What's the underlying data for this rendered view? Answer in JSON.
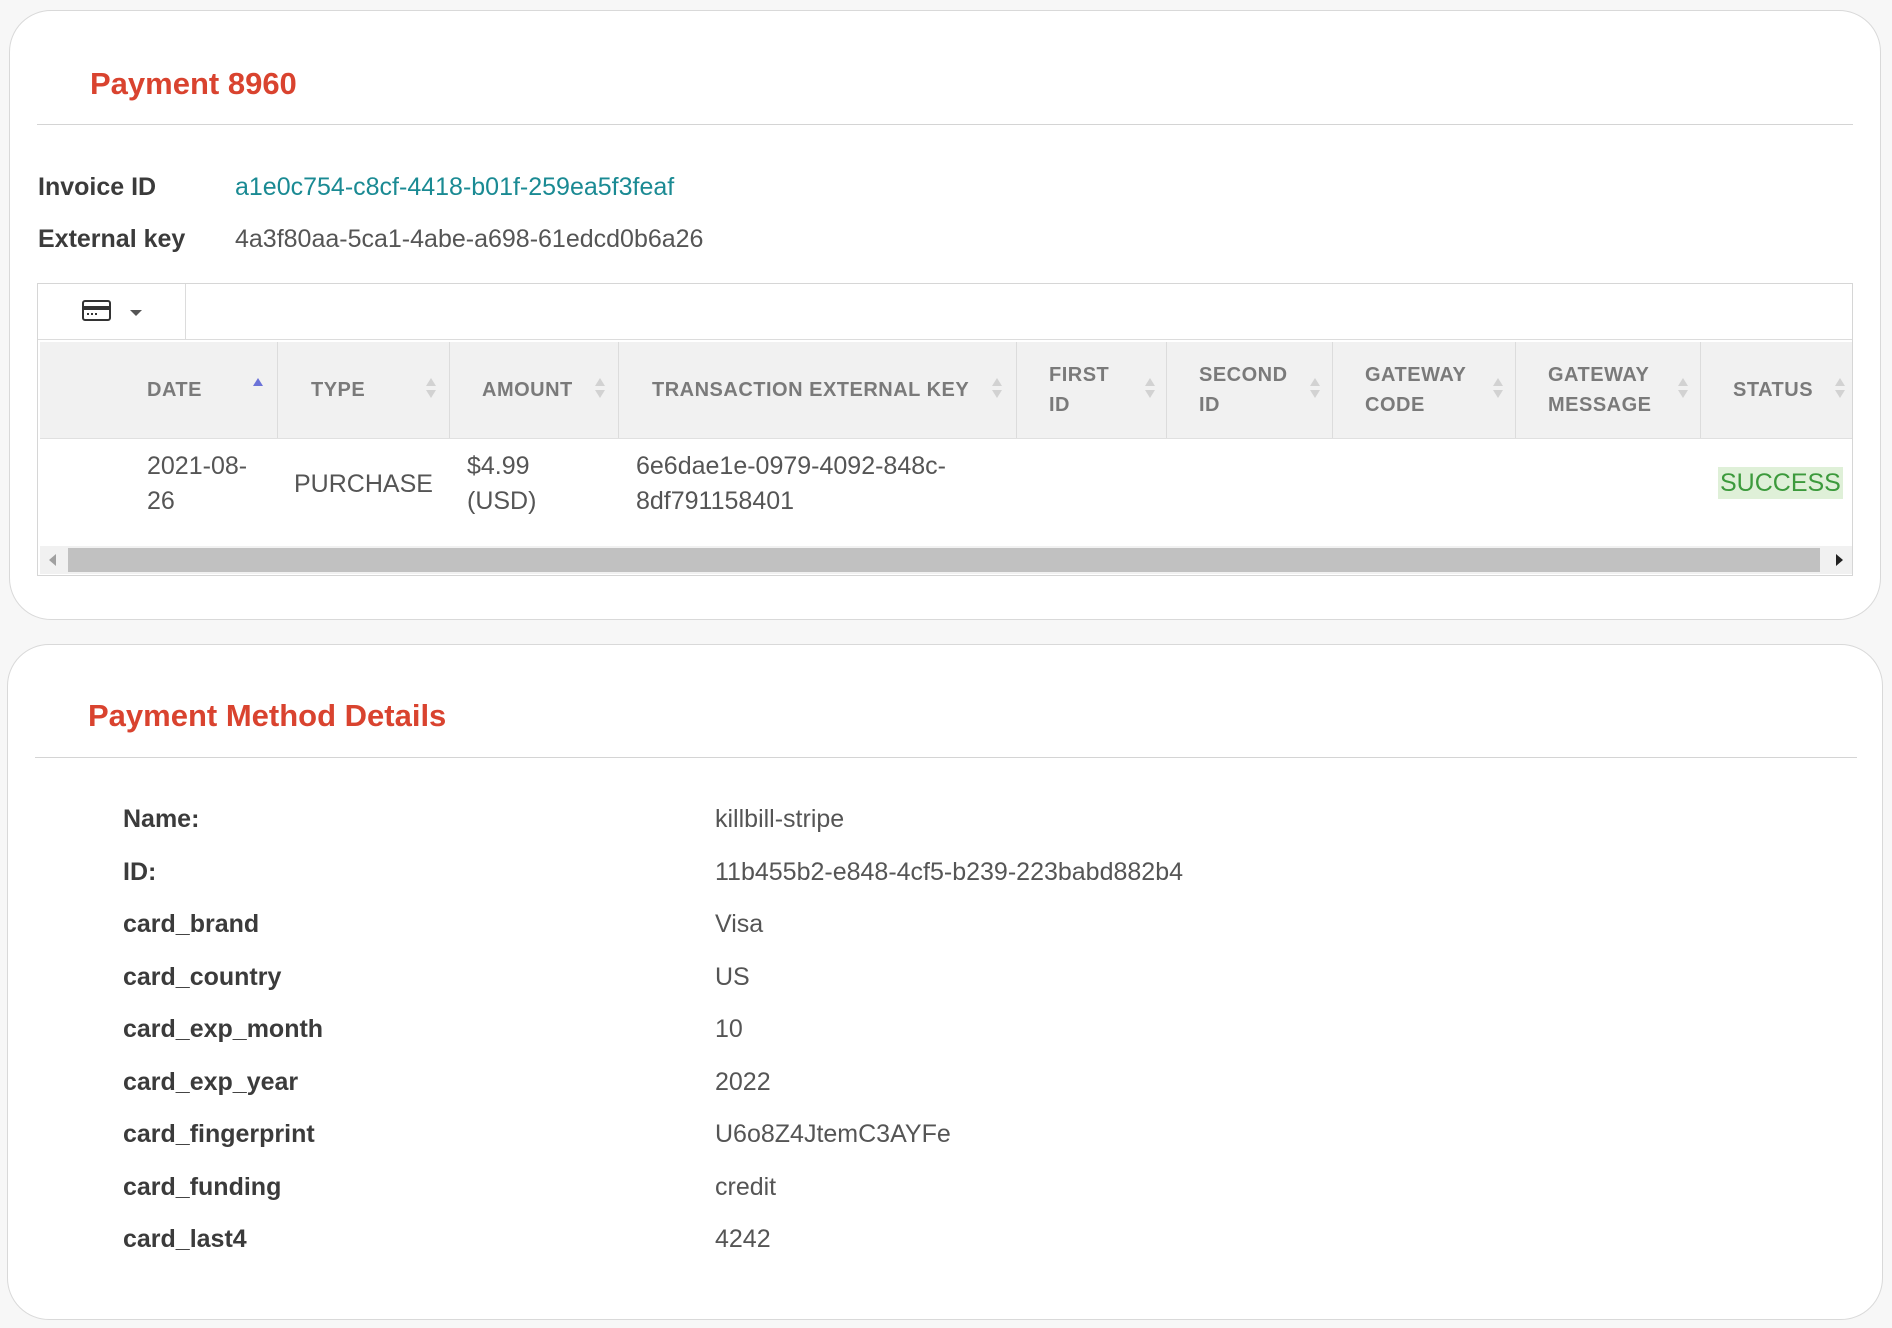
{
  "payment": {
    "title": "Payment 8960",
    "invoice_id_label": "Invoice ID",
    "invoice_id_value": "a1e0c754-c8cf-4418-b01f-259ea5f3feaf",
    "external_key_label": "External key",
    "external_key_value": "4a3f80aa-5ca1-4abe-a698-61edcd0b6a26"
  },
  "table": {
    "toolbar": {
      "icon": "credit-card-icon"
    },
    "columns": [
      {
        "line1": "DATE",
        "line2": "",
        "sort": "asc"
      },
      {
        "line1": "TYPE",
        "line2": "",
        "sort": "none"
      },
      {
        "line1": "AMOUNT",
        "line2": "",
        "sort": "none"
      },
      {
        "line1": "TRANSACTION EXTERNAL KEY",
        "line2": "",
        "sort": "none"
      },
      {
        "line1": "FIRST",
        "line2": "ID",
        "sort": "none"
      },
      {
        "line1": "SECOND",
        "line2": "ID",
        "sort": "none"
      },
      {
        "line1": "GATEWAY",
        "line2": "CODE",
        "sort": "none"
      },
      {
        "line1": "GATEWAY",
        "line2": "MESSAGE",
        "sort": "none"
      },
      {
        "line1": "STATUS",
        "line2": "",
        "sort": "none"
      }
    ],
    "rows": [
      {
        "date_line1": "2021-08-",
        "date_line2": "26",
        "type": "PURCHASE",
        "amount_line1": "$4.99",
        "amount_line2": "(USD)",
        "external_key_line1": "6e6dae1e-0979-4092-848c-",
        "external_key_line2": "8df791158401",
        "first_id": "",
        "second_id": "",
        "gateway_code": "",
        "gateway_message": "",
        "status": "SUCCESS"
      }
    ]
  },
  "method": {
    "title": "Payment Method Details",
    "fields": [
      {
        "label": "Name:",
        "value": "killbill-stripe"
      },
      {
        "label": "ID:",
        "value": "11b455b2-e848-4cf5-b239-223babd882b4"
      },
      {
        "label": "card_brand",
        "value": "Visa"
      },
      {
        "label": "card_country",
        "value": "US"
      },
      {
        "label": "card_exp_month",
        "value": "10"
      },
      {
        "label": "card_exp_year",
        "value": "2022"
      },
      {
        "label": "card_fingerprint",
        "value": "U6o8Z4JtemC3AYFe"
      },
      {
        "label": "card_funding",
        "value": "credit"
      },
      {
        "label": "card_last4",
        "value": "4242"
      }
    ]
  },
  "colors": {
    "title": "#d9432f",
    "link": "#1a8a93",
    "success_bg": "#dff0d8",
    "success_text": "#3c9a3c",
    "sort_active": "#6c73d8"
  }
}
